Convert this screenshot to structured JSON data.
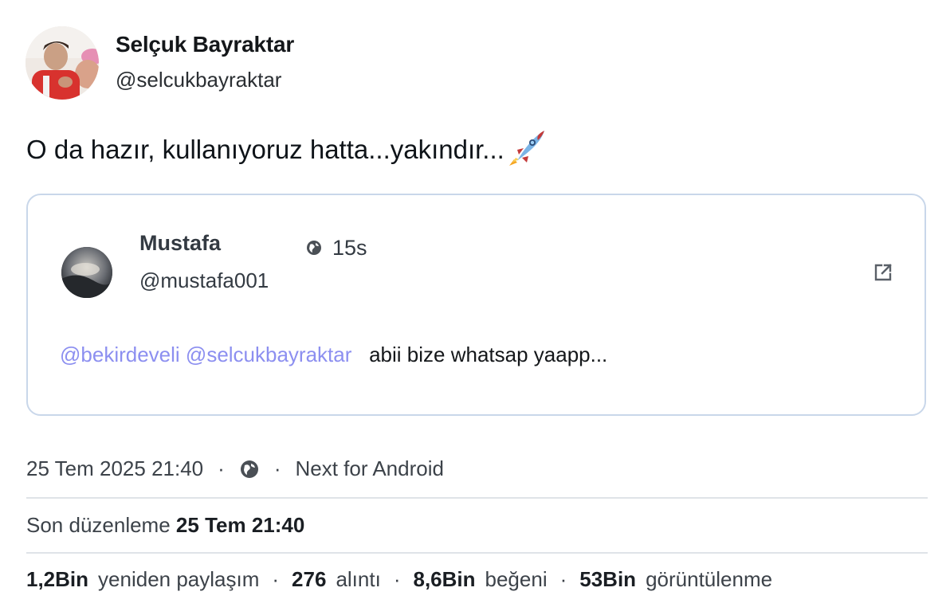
{
  "post": {
    "author_name": "Selçuk Bayraktar",
    "author_handle": "@selcukbayraktar",
    "text": "O da hazır, kullanıyoruz hatta...yakındır...",
    "emoji_icon": "rocket-emoji"
  },
  "quote": {
    "author_name": "Mustafa",
    "author_handle": "@mustafa001",
    "visibility_icon": "globe-icon",
    "relative_time": "15s",
    "mention_1": "@bekirdeveli",
    "mention_2": "@selcukbayraktar",
    "text": "abii bize whatsap yaapp...",
    "open_icon": "external-link-icon"
  },
  "meta": {
    "timestamp": "25 Tem 2025 21:40",
    "separator": "·",
    "visibility_icon": "globe-icon",
    "client": "Next for Android"
  },
  "edit": {
    "label": "Son düzenleme",
    "time": "25 Tem 21:40"
  },
  "stats": {
    "reposts_count": "1,2Bin",
    "reposts_label": "yeniden paylaşım",
    "quotes_count": "276",
    "quotes_label": "alıntı",
    "likes_count": "8,6Bin",
    "likes_label": "beğeni",
    "views_count": "53Bin",
    "views_label": "görüntülenme"
  },
  "colors": {
    "mention": "#8c8ff0",
    "card_border": "#c9d7ea",
    "divider": "#dfe3e8"
  }
}
